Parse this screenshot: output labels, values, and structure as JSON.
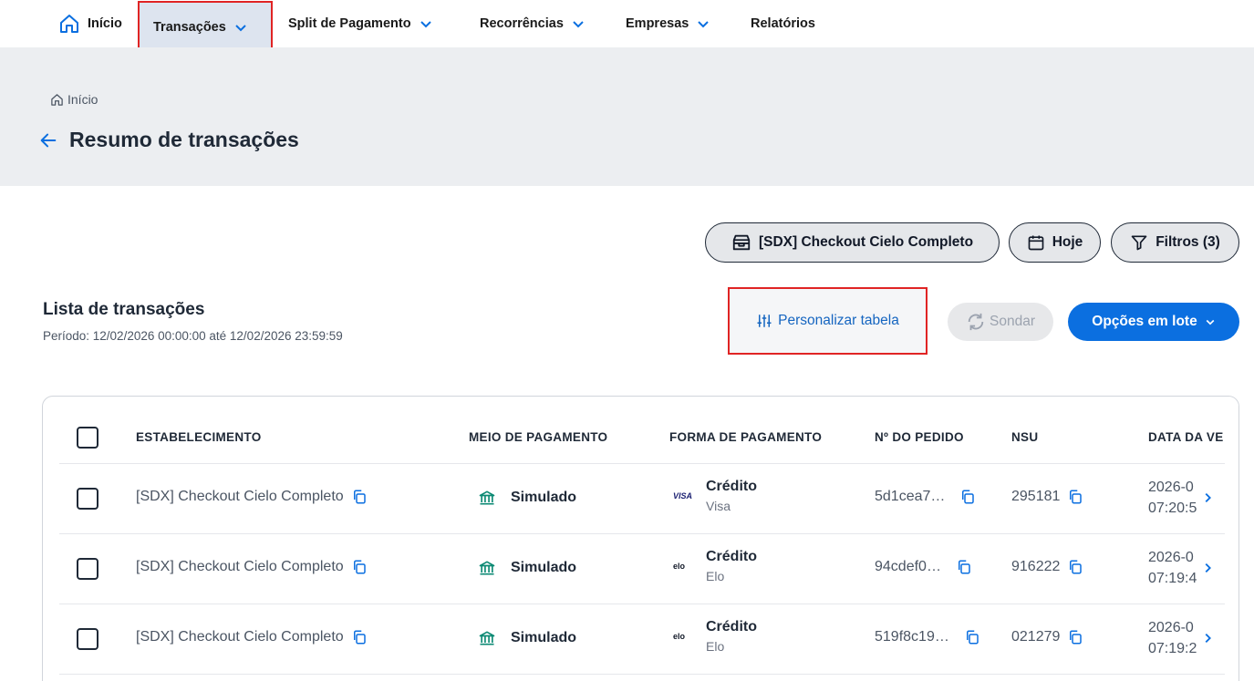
{
  "nav": {
    "home": "Início",
    "transactions": "Transações",
    "split": "Split de Pagamento",
    "recurrences": "Recorrências",
    "companies": "Empresas",
    "reports": "Relatórios"
  },
  "breadcrumb": {
    "home": "Início"
  },
  "page": {
    "title": "Resumo de transações"
  },
  "pills": {
    "store": "[SDX] Checkout Cielo Completo",
    "today": "Hoje",
    "filters": "Filtros (3)"
  },
  "list": {
    "title": "Lista de transações",
    "period": "Período: 12/02/2026 00:00:00 até 12/02/2026 23:59:59",
    "customize": "Personalizar tabela",
    "sondar": "Sondar",
    "batch": "Opções em lote"
  },
  "table": {
    "headers": {
      "establishment": "ESTABELECIMENTO",
      "payment_method": "MEIO DE PAGAMENTO",
      "payment_form": "FORMA DE PAGAMENTO",
      "order": "Nº DO PEDIDO",
      "nsu": "NSU",
      "date": "DATA DA VE"
    },
    "rows": [
      {
        "establishment": "[SDX] Checkout Cielo Completo",
        "method": "Simulado",
        "form": "Crédito",
        "brand": "Visa",
        "brand_logo": "VISA",
        "order": "5d1cea7…",
        "nsu": "295181",
        "date": "2026-0",
        "time": "07:20:5"
      },
      {
        "establishment": "[SDX] Checkout Cielo Completo",
        "method": "Simulado",
        "form": "Crédito",
        "brand": "Elo",
        "brand_logo": "elo",
        "order": "94cdef0…",
        "nsu": "916222",
        "date": "2026-0",
        "time": "07:19:4"
      },
      {
        "establishment": "[SDX] Checkout Cielo Completo",
        "method": "Simulado",
        "form": "Crédito",
        "brand": "Elo",
        "brand_logo": "elo",
        "order": "519f8c19…",
        "nsu": "021279",
        "date": "2026-0",
        "time": "07:19:2"
      }
    ]
  },
  "colors": {
    "accent": "#0b6fe0",
    "highlight": "#e02424",
    "bank_icon": "#0d8a74"
  }
}
